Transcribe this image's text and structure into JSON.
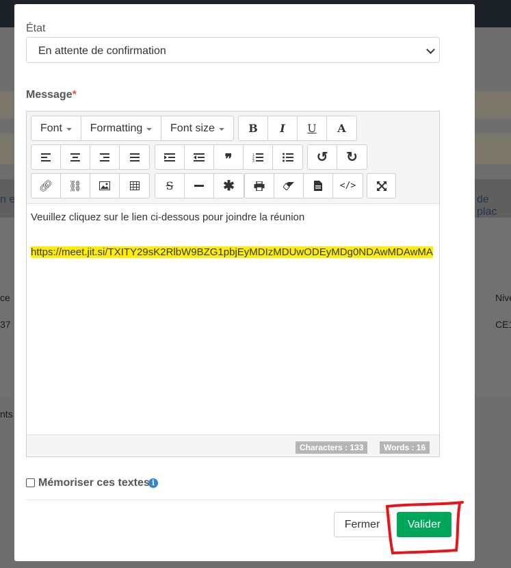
{
  "background": {
    "left_fragment_1": "n e",
    "left_fragment_2": "ce",
    "left_fragment_3": "37",
    "left_fragment_4": "nts",
    "right_fragment_1": "de plac",
    "right_fragment_2": "Nive",
    "right_fragment_3": "CE1"
  },
  "modal": {
    "etat_label": "État",
    "etat_value": "En attente de confirmation",
    "message_label": "Message",
    "required_mark": "*",
    "toolbar": {
      "font": "Font",
      "formatting": "Formatting",
      "font_size": "Font size",
      "bold": "B",
      "italic": "I",
      "underline": "U",
      "text_color": "A"
    },
    "editor": {
      "line1": "Veuillez cliquez sur le lien ci-dessous pour joindre la réunion",
      "link": "https://meet.jit.si/TXITY29sK2RlbW9BZG1pbjEyMDIzMDUwODEyMDg0NDAwMDAwMA",
      "characters": "Characters : 133",
      "words": "Words : 16"
    },
    "memoriser_label": "Mémoriser ces textes",
    "info_icon": "i",
    "fermer_label": "Fermer",
    "valider_label": "Valider"
  },
  "colors": {
    "primary_green": "#00a65a",
    "highlight_yellow": "#ffee00",
    "annotation_red": "#e8141c",
    "required_red": "#d9534f"
  }
}
